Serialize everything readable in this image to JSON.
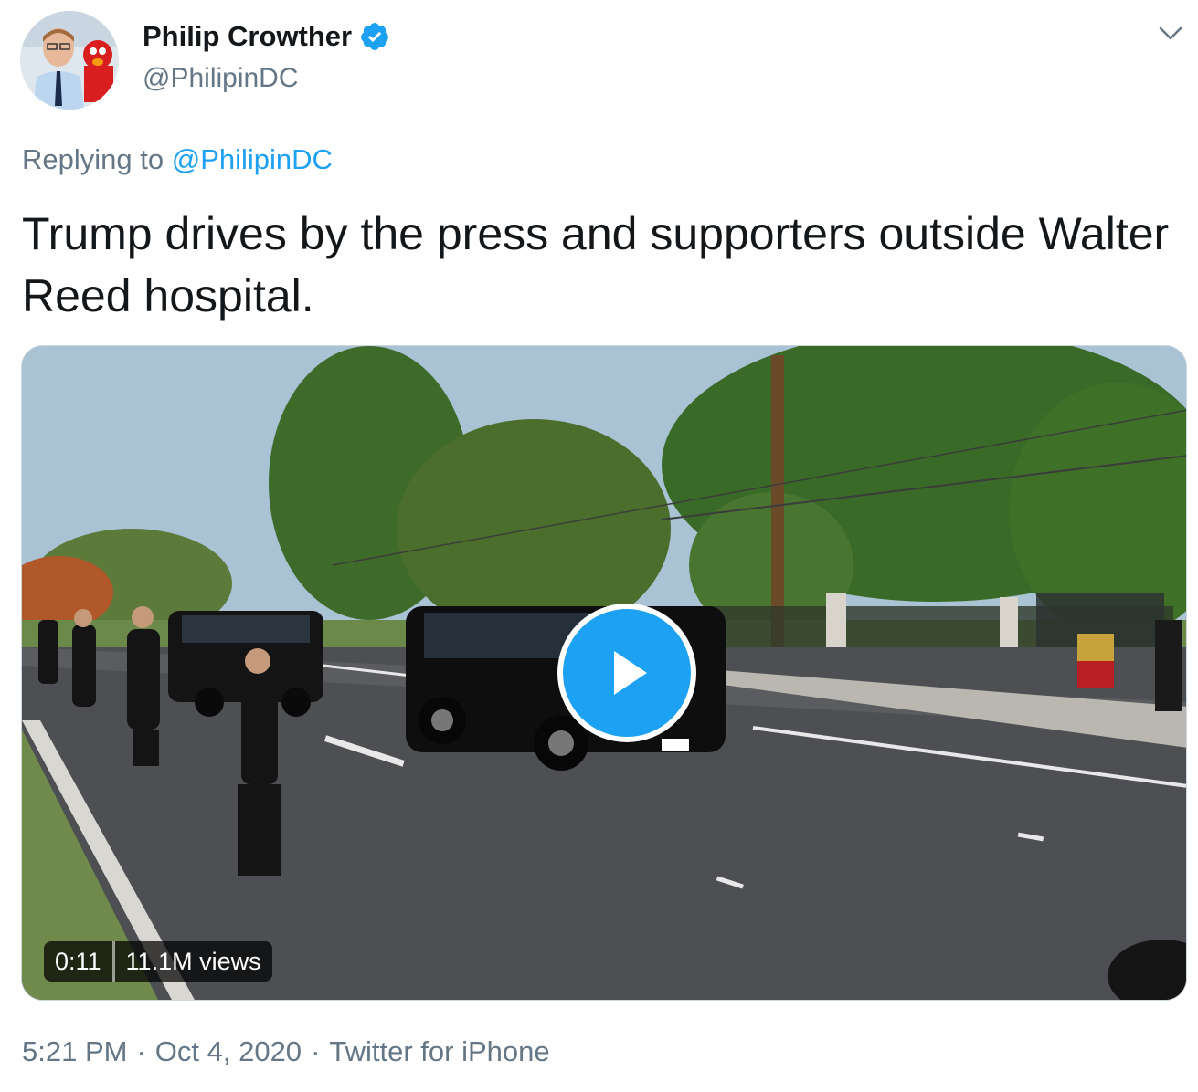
{
  "author": {
    "display_name": "Philip Crowther",
    "handle": "@PhilipinDC",
    "verified": true
  },
  "reply": {
    "prefix": "Replying to",
    "mention": "@PhilipinDC"
  },
  "tweet": {
    "text": "Trump drives by the press and supporters outside Walter Reed hospital."
  },
  "media": {
    "type": "video",
    "duration": "0:11",
    "views": "11.1M views"
  },
  "footer": {
    "time": "5:21 PM",
    "date": "Oct 4, 2020",
    "source": "Twitter for iPhone",
    "separator": "·"
  },
  "colors": {
    "accent": "#1da1f2",
    "secondary_text": "#657786",
    "primary_text": "#14171a"
  },
  "icons": {
    "verified": "verified-badge-icon",
    "menu": "chevron-down-icon",
    "play": "play-icon"
  }
}
